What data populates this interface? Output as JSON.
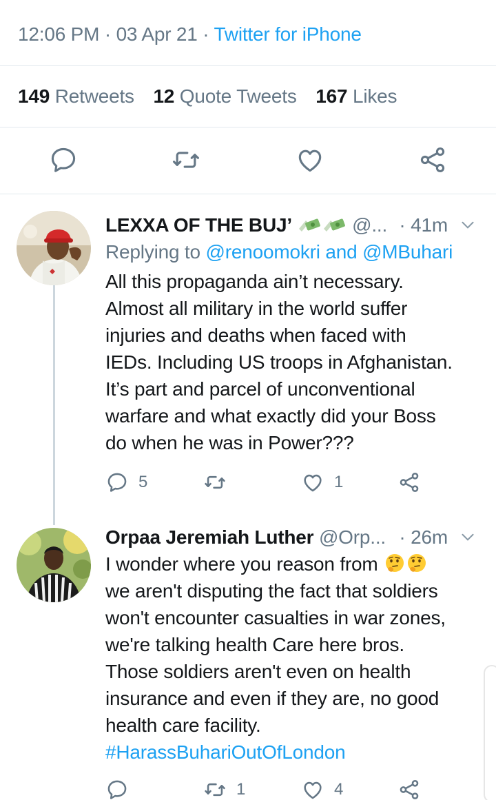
{
  "tweet_meta": {
    "time": "12:06 PM",
    "date": "03 Apr 21",
    "sep": "·",
    "source": "Twitter for iPhone"
  },
  "stats": {
    "retweets": {
      "count": "149",
      "label": "Retweets"
    },
    "quotes": {
      "count": "12",
      "label": "Quote Tweets"
    },
    "likes": {
      "count": "167",
      "label": "Likes"
    }
  },
  "main_actions": [
    "reply-icon",
    "retweet-icon",
    "like-icon",
    "share-icon"
  ],
  "replies": [
    {
      "name": "LEXXA OF THE BUJ’",
      "handle": "@...",
      "time": "· 41m",
      "replying_prefix": "Replying to",
      "mention_1": "@renoomokri",
      "and": "and",
      "mention_2": "@MBuhari",
      "lines": [
        "All this propaganda ain’t necessary.",
        "Almost all military in the world suffer",
        "injuries and deaths when faced with",
        "IEDs. Including US troops in Afghanistan.",
        "It’s part and parcel of unconventional",
        "warfare and what exactly did your Boss",
        "do when he was in Power???"
      ],
      "reply_count": "5",
      "retweet_count": "",
      "like_count": "1"
    },
    {
      "name": "Orpaa Jeremiah Luther",
      "handle": "@Orp...",
      "time": "· 26m",
      "lines": [
        "I wonder where you reason from",
        "we aren't disputing the fact that soldiers",
        "won't encounter casualties in war zones,",
        "we're talking health Care here bros.",
        "Those soldiers aren't even on health",
        "insurance and even if they are, no good",
        "health care facility."
      ],
      "hashtag": "#HarassBuhariOutOfLondon",
      "reply_count": "",
      "retweet_count": "1",
      "like_count": "4"
    }
  ],
  "colors": {
    "accent": "#1da1f2",
    "secondary_text": "#657786",
    "primary_text": "#14171a",
    "divider": "#e1e8ed",
    "thread_line": "#ccd6dd"
  }
}
